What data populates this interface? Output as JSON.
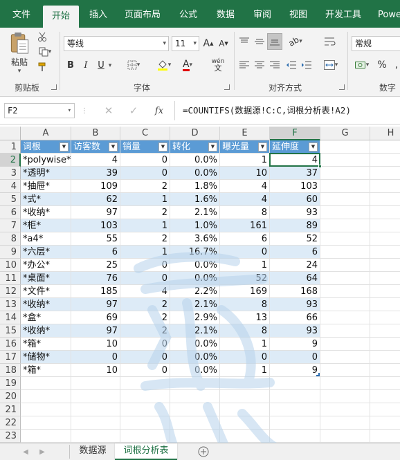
{
  "ribbon_tabs": [
    "文件",
    "开始",
    "插入",
    "页面布局",
    "公式",
    "数据",
    "审阅",
    "视图",
    "开发工具",
    "Powe"
  ],
  "ribbon": {
    "clipboard": {
      "paste_label": "粘贴",
      "group_label": "剪贴板"
    },
    "font": {
      "font_name": "等线",
      "font_size": "11",
      "phonetic_label": "wén",
      "group_label": "字体",
      "bold": "B",
      "italic": "I",
      "underline": "U"
    },
    "alignment": {
      "group_label": "对齐方式"
    },
    "number": {
      "format": "常规",
      "group_label": "数字",
      "percent": "%"
    }
  },
  "formula_bar": {
    "name_box": "F2",
    "fx_label": "fx",
    "formula": "=COUNTIFS(数据源!C:C,词根分析表!A2)"
  },
  "grid": {
    "columns": [
      "A",
      "B",
      "C",
      "D",
      "E",
      "F",
      "G",
      "H"
    ],
    "rows": [
      "1",
      "2",
      "3",
      "4",
      "5",
      "6",
      "7",
      "8",
      "9",
      "10",
      "11",
      "12",
      "13",
      "14",
      "15",
      "16",
      "17",
      "18",
      "19",
      "20",
      "21",
      "22",
      "23"
    ],
    "headers": [
      "词根",
      "访客数",
      "销量",
      "转化",
      "曝光量",
      "延伸度"
    ],
    "data": [
      [
        "*polywise*",
        "4",
        "0",
        "0.0%",
        "1",
        "4"
      ],
      [
        "*透明*",
        "39",
        "0",
        "0.0%",
        "10",
        "37"
      ],
      [
        "*抽屉*",
        "109",
        "2",
        "1.8%",
        "4",
        "103"
      ],
      [
        "*式*",
        "62",
        "1",
        "1.6%",
        "4",
        "60"
      ],
      [
        "*收纳*",
        "97",
        "2",
        "2.1%",
        "8",
        "93"
      ],
      [
        "*柜*",
        "103",
        "1",
        "1.0%",
        "161",
        "89"
      ],
      [
        "*a4*",
        "55",
        "2",
        "3.6%",
        "6",
        "52"
      ],
      [
        "*六层*",
        "6",
        "1",
        "16.7%",
        "0",
        "6"
      ],
      [
        "*办公*",
        "25",
        "0",
        "0.0%",
        "1",
        "24"
      ],
      [
        "*桌面*",
        "76",
        "0",
        "0.0%",
        "52",
        "64"
      ],
      [
        "*文件*",
        "185",
        "4",
        "2.2%",
        "169",
        "168"
      ],
      [
        "*收纳*",
        "97",
        "2",
        "2.1%",
        "8",
        "93"
      ],
      [
        "*盒*",
        "69",
        "2",
        "2.9%",
        "13",
        "66"
      ],
      [
        "*收纳*",
        "97",
        "2",
        "2.1%",
        "8",
        "93"
      ],
      [
        "*箱*",
        "10",
        "0",
        "0.0%",
        "1",
        "9"
      ],
      [
        "*储物*",
        "0",
        "0",
        "0.0%",
        "0",
        "0"
      ],
      [
        "*箱*",
        "10",
        "0",
        "0.0%",
        "1",
        "9"
      ]
    ]
  },
  "sheets": [
    "数据源",
    "词根分析表"
  ],
  "active_sheet": "词根分析表",
  "colors": {
    "accent": "#217346",
    "table_header": "#5b9bd5",
    "band": "#ddebf7"
  }
}
